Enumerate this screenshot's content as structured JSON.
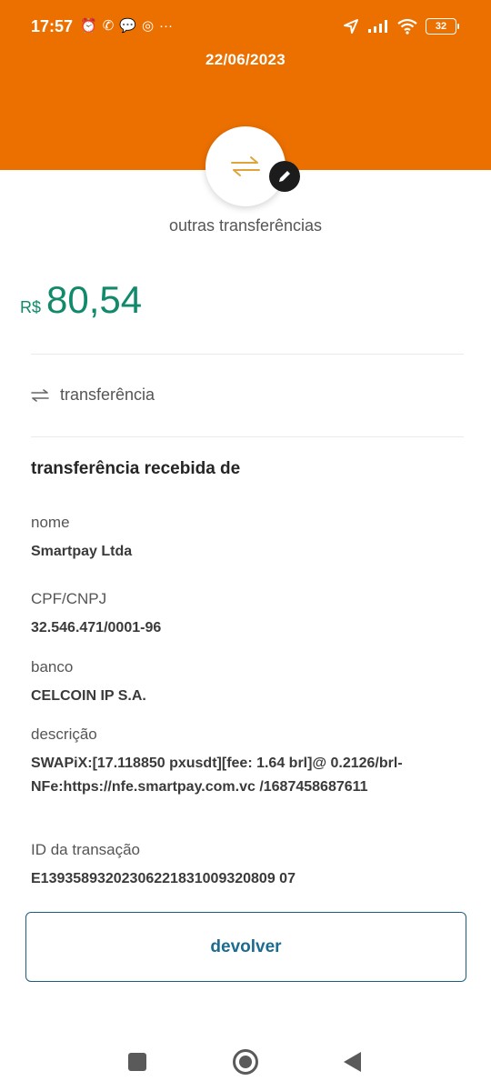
{
  "status_bar": {
    "time": "17:57",
    "icons_left": [
      "alarm-icon",
      "whatsapp-icon",
      "chat-icon",
      "instagram-icon",
      "more-icon"
    ],
    "battery": "32"
  },
  "header": {
    "date": "22/06/2023",
    "background": "#ec7000"
  },
  "transaction": {
    "category": "outras transferências",
    "currency": "R$",
    "amount": "80,54",
    "amount_color": "#108a6a",
    "type_label": "transferência"
  },
  "details": {
    "section_title": "transferência recebida de",
    "name_label": "nome",
    "name_value": "Smartpay Ltda",
    "doc_label": "CPF/CNPJ",
    "doc_value": "32.546.471/0001-96",
    "bank_label": "banco",
    "bank_value": "CELCOIN IP S.A.",
    "description_label": "descrição",
    "description_value": "SWAPiX:[17.118850 pxusdt][fee: 1.64 brl]@ 0.2126/brl-NFe:https://nfe.smartpay.com.vc /1687458687611",
    "id_label": "ID da transação",
    "id_value": "E13935893202306221831009320809 07"
  },
  "actions": {
    "return_label": "devolver"
  }
}
